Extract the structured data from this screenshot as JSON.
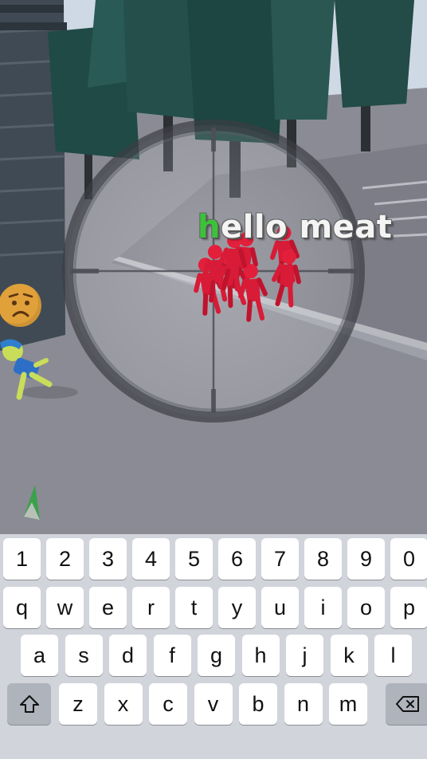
{
  "game": {
    "typed_done": "h",
    "typed_rest": "ello meat",
    "emoji": "😟"
  },
  "keyboard": {
    "row_numbers": [
      "1",
      "2",
      "3",
      "4",
      "5",
      "6",
      "7",
      "8",
      "9",
      "0"
    ],
    "row_top": [
      "q",
      "w",
      "e",
      "r",
      "t",
      "y",
      "u",
      "i",
      "o",
      "p"
    ],
    "row_home": [
      "a",
      "s",
      "d",
      "f",
      "g",
      "h",
      "j",
      "k",
      "l"
    ],
    "row_bottom": [
      "z",
      "x",
      "c",
      "v",
      "b",
      "n",
      "m"
    ],
    "shift_icon": "shift-icon",
    "backspace_icon": "backspace-icon"
  }
}
